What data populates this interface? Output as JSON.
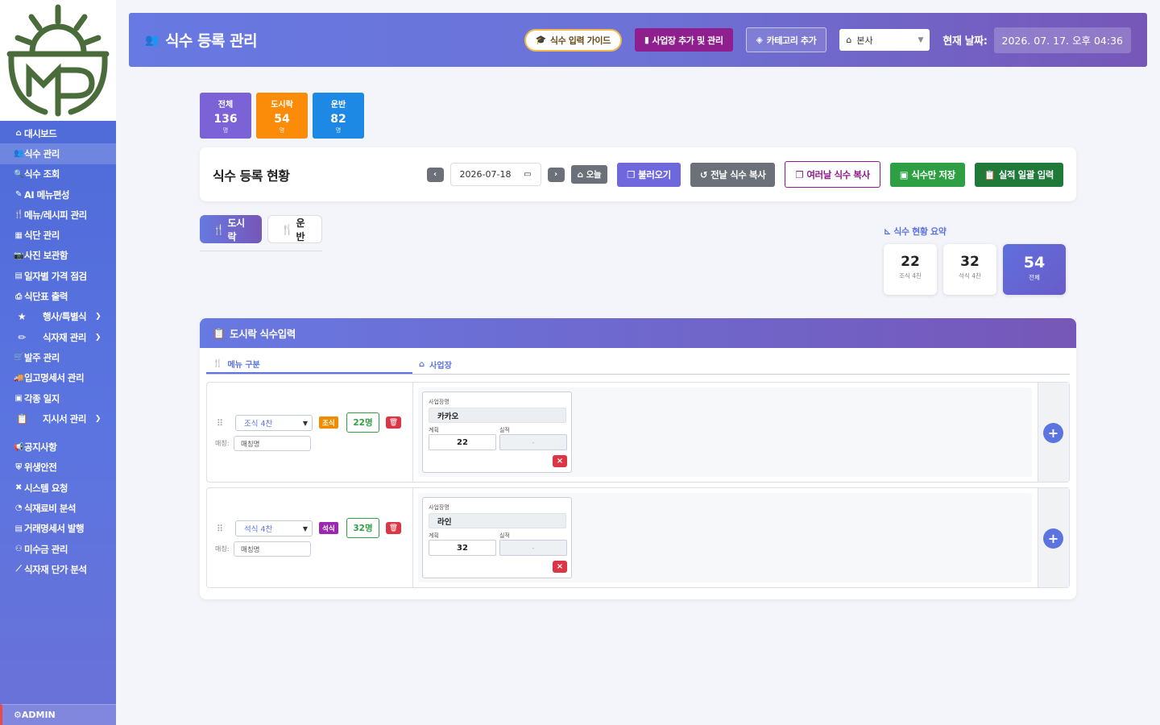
{
  "sidebar": {
    "items": [
      {
        "icon": "home-icon",
        "glyph": "⌂",
        "label": "대시보드"
      },
      {
        "icon": "users-icon",
        "glyph": "👥",
        "label": "식수 관리"
      },
      {
        "icon": "search-icon",
        "glyph": "🔍",
        "label": "식수 조회"
      },
      {
        "icon": "pen-icon",
        "glyph": "✎",
        "label": "AI 메뉴편성"
      },
      {
        "icon": "utensils-icon",
        "glyph": "🍴",
        "label": "메뉴/레시피 관리"
      },
      {
        "icon": "calendar-icon",
        "glyph": "▦",
        "label": "식단 관리"
      },
      {
        "icon": "camera-icon",
        "glyph": "📷",
        "label": "사진 보관함"
      },
      {
        "icon": "calendar-check-icon",
        "glyph": "▤",
        "label": "일자별 가격 점검"
      },
      {
        "icon": "print-icon",
        "glyph": "⎙",
        "label": "식단표 출력"
      }
    ],
    "groups": [
      {
        "icon": "star-icon",
        "glyph": "★",
        "label": "행사/특별식"
      },
      {
        "icon": "carrot-icon",
        "glyph": "✏",
        "label": "식자재 관리"
      }
    ],
    "items2": [
      {
        "icon": "cart-icon",
        "glyph": "🛒",
        "label": "발주 관리"
      },
      {
        "icon": "truck-icon",
        "glyph": "🚚",
        "label": "입고명세서 관리"
      },
      {
        "icon": "book-icon",
        "glyph": "▣",
        "label": "각종 일지"
      }
    ],
    "group3": {
      "icon": "clipboard-icon",
      "glyph": "📋",
      "label": "지시서 관리"
    },
    "items3": [
      {
        "icon": "megaphone-icon",
        "glyph": "📢",
        "label": "공지사항"
      },
      {
        "icon": "shield-icon",
        "glyph": "⛨",
        "label": "위생안전"
      },
      {
        "icon": "tools-icon",
        "glyph": "✖",
        "label": "시스템 요청"
      },
      {
        "icon": "chart-pie-icon",
        "glyph": "◔",
        "label": "식재료비 분석"
      },
      {
        "icon": "invoice-icon",
        "glyph": "▤",
        "label": "거래명세서 발행"
      },
      {
        "icon": "hand-money-icon",
        "glyph": "⚇",
        "label": "미수금 관리"
      },
      {
        "icon": "chart-line-icon",
        "glyph": "⟋",
        "label": "식자재 단가 분석"
      }
    ],
    "admin": "ADMIN"
  },
  "header": {
    "title": "식수 등록 관리",
    "guide_btn": "식수 입력 가이드",
    "site_btn": "사업장 추가 및 관리",
    "category_btn": "카테고리 추가",
    "branch": "본사",
    "date_label": "현재 날짜:",
    "date_value": "2026. 07. 17. 오후 04:36"
  },
  "stats": [
    {
      "label": "전체",
      "value": "136",
      "unit": "명",
      "color": "#7b62d6"
    },
    {
      "label": "도시락",
      "value": "54",
      "unit": "명",
      "color": "#fb8c0a"
    },
    {
      "label": "운반",
      "value": "82",
      "unit": "명",
      "color": "#1e88e5"
    }
  ],
  "toolbar": {
    "title": "식수 등록 현황",
    "date": "2026-07-18",
    "today": "오늘",
    "load": "불러오기",
    "copy_prev": "전날 식수 복사",
    "copy_multi": "여러날 식수 복사",
    "save": "식수만 저장",
    "bulk": "실적 일괄 입력"
  },
  "tabs": {
    "lunchbox": "도시락",
    "transport": "운반"
  },
  "summary": {
    "title": "식수 현황 요약",
    "cards": [
      {
        "value": "22",
        "label": "조식 4찬"
      },
      {
        "value": "32",
        "label": "석식 4찬"
      }
    ],
    "total": {
      "value": "54",
      "label": "전체"
    }
  },
  "input_section": {
    "title": "도시락 식수입력",
    "col_menu": "메뉴 구분",
    "col_site": "사업장",
    "maech_label": "매칭:",
    "site_name_label": "사업장명",
    "plan_label": "계획",
    "actual_label": "실적",
    "rows": [
      {
        "menu": "조식 4찬",
        "badge": "조식",
        "badge_color": "#f08c00",
        "count": "22명",
        "maech_placeholder": "매칭명",
        "site": "카카오",
        "plan": "22",
        "actual": "-"
      },
      {
        "menu": "석식 4찬",
        "badge": "석식",
        "badge_color": "#9c27b0",
        "count": "32명",
        "maech_placeholder": "매칭명",
        "site": "라인",
        "plan": "32",
        "actual": "-"
      }
    ]
  }
}
